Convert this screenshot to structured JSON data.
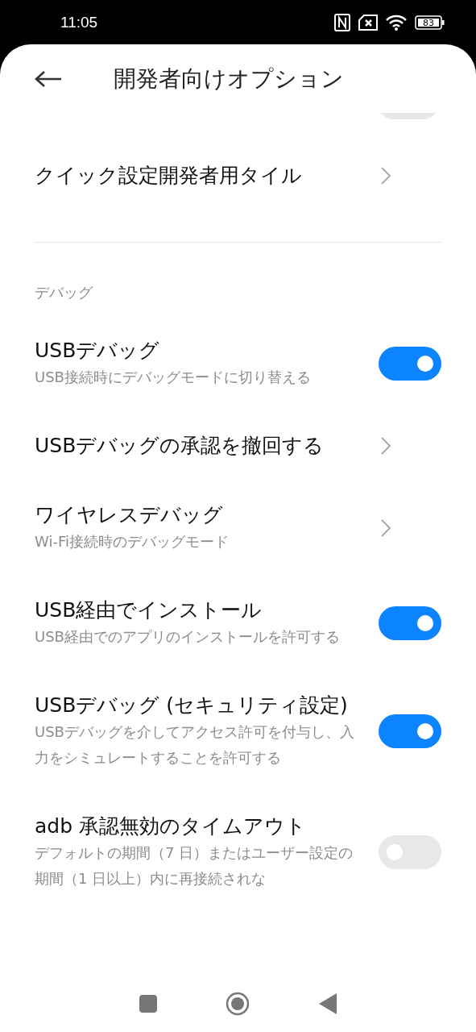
{
  "status_bar": {
    "time": "11:05",
    "battery": "83"
  },
  "header": {
    "title": "開発者向けオプション"
  },
  "partial_toggle": {
    "on": false
  },
  "items": [
    {
      "kind": "link",
      "title": "クイック設定開発者用タイル"
    },
    {
      "kind": "divider"
    },
    {
      "kind": "section",
      "title": "デバッグ"
    },
    {
      "kind": "toggle",
      "title": "USBデバッグ",
      "subtitle": "USB接続時にデバッグモードに切り替える",
      "on": true
    },
    {
      "kind": "link",
      "title": "USBデバッグの承認を撤回する"
    },
    {
      "kind": "link",
      "title": "ワイヤレスデバッグ",
      "subtitle": "Wi-Fi接続時のデバッグモード"
    },
    {
      "kind": "toggle",
      "title": "USB経由でインストール",
      "subtitle": "USB経由でのアプリのインストールを許可する",
      "on": true
    },
    {
      "kind": "toggle",
      "title": "USBデバッグ (セキュリティ設定)",
      "subtitle": "USBデバッグを介してアクセス許可を付与し、入力をシミュレートすることを許可する",
      "on": true
    },
    {
      "kind": "toggle",
      "title": "adb 承認無効のタイムアウト",
      "subtitle": "デフォルトの期間（7 日）またはユーザー設定の期間（1 日以上）内に再接続されな",
      "on": false
    }
  ]
}
